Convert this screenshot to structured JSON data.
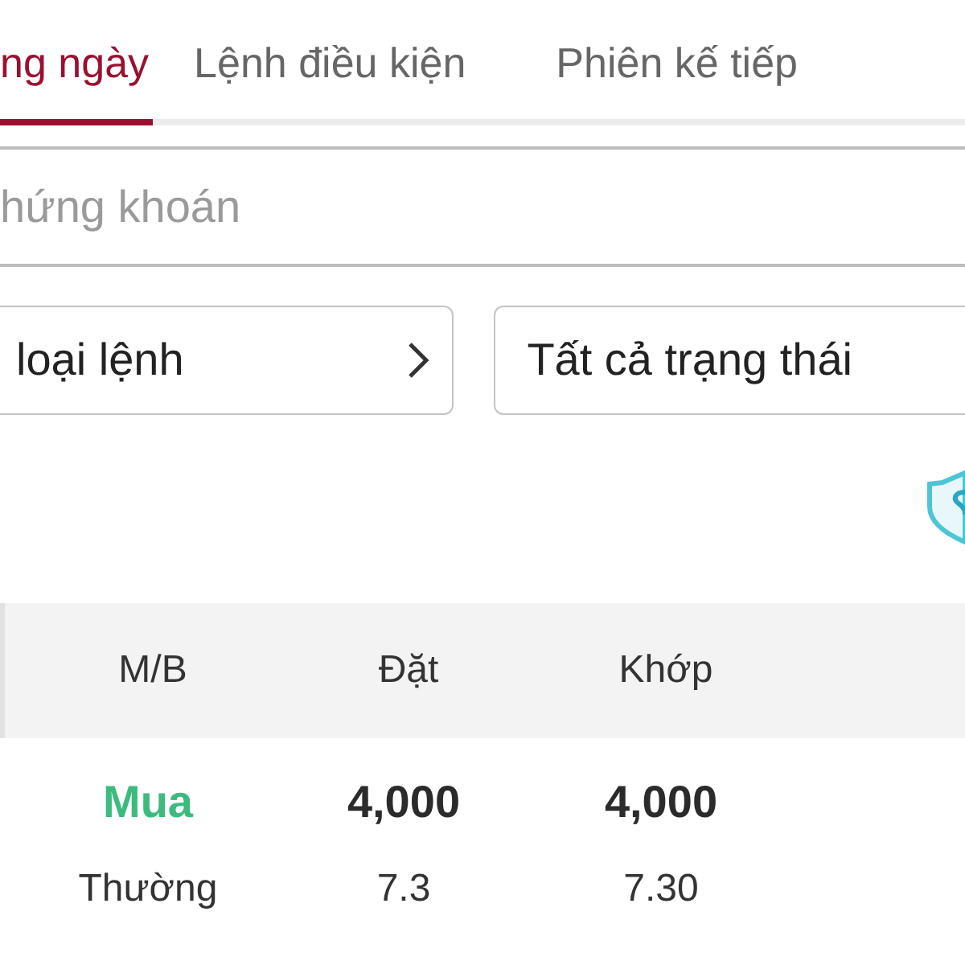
{
  "tabs": [
    {
      "label": "ng ngày",
      "selected": true
    },
    {
      "label": "Lệnh điều kiện",
      "selected": false
    },
    {
      "label": "Phiên kế tiếp",
      "selected": false
    }
  ],
  "search": {
    "placeholder": "hứng khoán"
  },
  "filters": [
    {
      "value": "loại lệnh",
      "kind": "chevron"
    },
    {
      "value": "Tất cả trạng thái",
      "kind": "plain"
    }
  ],
  "table": {
    "columns": [
      "M/B",
      "Đặt",
      "Khớp"
    ],
    "rows": [
      [
        {
          "text": "Mua",
          "kind": "side"
        },
        {
          "text": "4,000",
          "kind": "bold"
        },
        {
          "text": "4,000",
          "kind": "bold"
        }
      ],
      [
        {
          "text": "Thường",
          "kind": "plain"
        },
        {
          "text": "7.3",
          "kind": "plain"
        },
        {
          "text": "7.30",
          "kind": "plain"
        }
      ]
    ]
  }
}
